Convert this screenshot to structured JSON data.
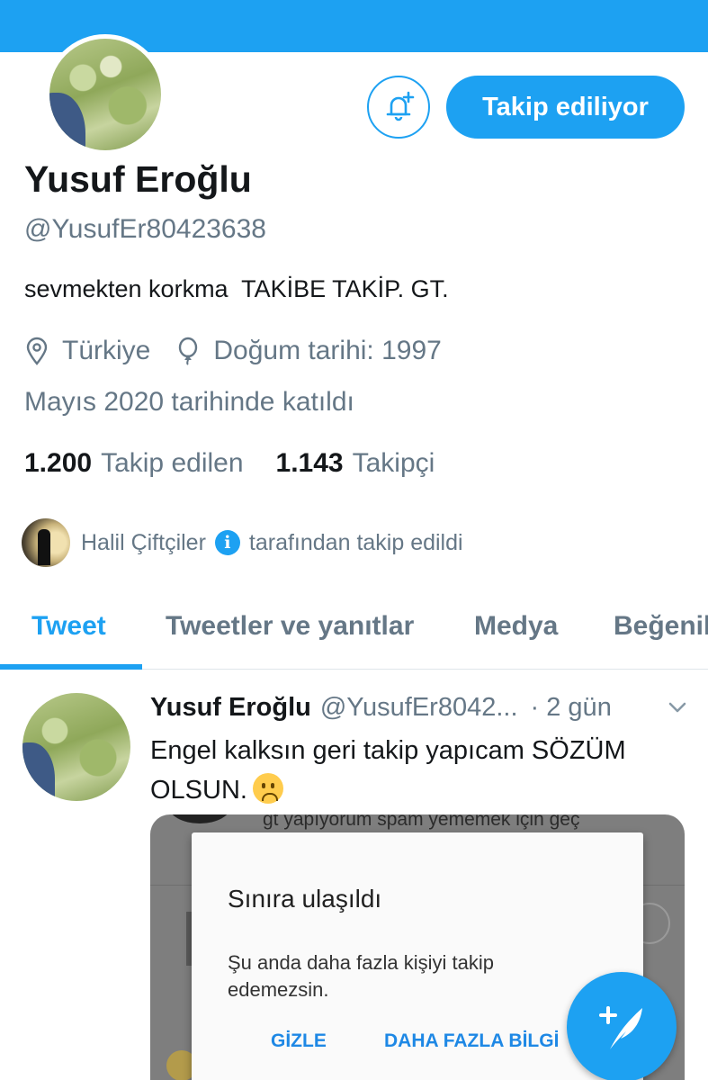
{
  "profile": {
    "name": "Yusuf Eroğlu",
    "handle": "@YusufEr80423638",
    "bio": "sevmekten korkma  TAKİBE TAKİP. GT.",
    "location": "Türkiye",
    "birthday": "Doğum tarihi: 1997",
    "joined": "Mayıs 2020 tarihinde katıldı",
    "following_count": "1.200",
    "following_label": "Takip edilen",
    "followers_count": "1.143",
    "followers_label": "Takipçi"
  },
  "actions": {
    "follow_label": "Takip ediliyor",
    "notify_icon": "bell-plus-icon"
  },
  "followed_by": {
    "name": "Halil Çiftçiler",
    "suffix": "tarafından takip edildi"
  },
  "tabs": [
    {
      "label": "Tweet",
      "active": true
    },
    {
      "label": "Tweetler ve yanıtlar",
      "active": false
    },
    {
      "label": "Medya",
      "active": false
    },
    {
      "label": "Beğeniler",
      "active": false
    }
  ],
  "tweet": {
    "name": "Yusuf Eroğlu",
    "handle": "@YusufEr8042...",
    "time": "· 2 gün",
    "text": "Engel kalksın geri takip yapıcam SÖZÜM OLSUN.",
    "media": {
      "background_text": "gt yapıyorum spam yememek için geç",
      "dialog_title": "Sınıra ulaşıldı",
      "dialog_message": "Şu anda daha fazla kişiyi takip edemezsin.",
      "dialog_button_hide": "GİZLE",
      "dialog_button_more": "DAHA FAZLA BİLGİ"
    }
  },
  "colors": {
    "accent": "#1da1f2",
    "text_primary": "#14171a",
    "text_secondary": "#657786"
  }
}
